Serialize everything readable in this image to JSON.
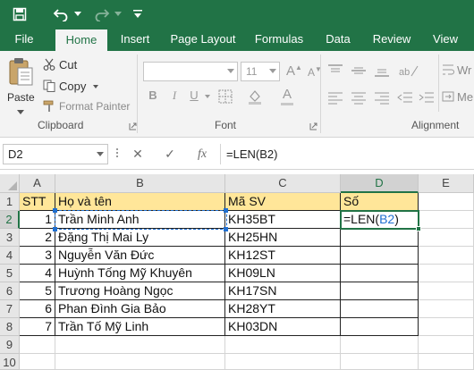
{
  "quick_access": {
    "save": "save-icon",
    "undo": "undo-icon",
    "redo": "redo-icon",
    "customize": "chevron-down-icon"
  },
  "tabs": [
    {
      "label": "File",
      "active": false
    },
    {
      "label": "Home",
      "active": true
    },
    {
      "label": "Insert",
      "active": false
    },
    {
      "label": "Page Layout",
      "active": false
    },
    {
      "label": "Formulas",
      "active": false
    },
    {
      "label": "Data",
      "active": false
    },
    {
      "label": "Review",
      "active": false
    },
    {
      "label": "View",
      "active": false
    }
  ],
  "ribbon": {
    "clipboard": {
      "paste": "Paste",
      "cut": "Cut",
      "copy": "Copy",
      "format_painter": "Format Painter",
      "group_label": "Clipboard"
    },
    "font": {
      "font_name": "",
      "font_size": "11",
      "bold": "B",
      "italic": "I",
      "underline": "U",
      "group_label": "Font"
    },
    "alignment": {
      "wrap": "Wr",
      "merge": "Me",
      "group_label": "Alignment"
    }
  },
  "formula_bar": {
    "name_box": "D2",
    "cancel": "✕",
    "enter": "✓",
    "fx": "fx",
    "formula_prefix": "=LEN(",
    "formula_ref": "B2",
    "formula_suffix": ")"
  },
  "columns": [
    "A",
    "B",
    "C",
    "D",
    "E"
  ],
  "rows": [
    "1",
    "2",
    "3",
    "4",
    "5",
    "6",
    "7",
    "8",
    "9",
    "10"
  ],
  "headers": {
    "stt": "STT",
    "name": "Họ và tên",
    "code": "Mã SV",
    "count": "Số"
  },
  "records": [
    {
      "stt": "1",
      "name": "Trần Minh Anh",
      "code": "KH35BT"
    },
    {
      "stt": "2",
      "name": "Đặng Thị Mai Ly",
      "code": "KH25HN"
    },
    {
      "stt": "3",
      "name": "Nguyễn Văn Đức",
      "code": "KH12ST"
    },
    {
      "stt": "4",
      "name": "Huỳnh Tống Mỹ Khuyên",
      "code": "KH09LN"
    },
    {
      "stt": "5",
      "name": "Trương Hoàng Ngọc",
      "code": "KH17SN"
    },
    {
      "stt": "6",
      "name": "Phan Đình Gia Bảo",
      "code": "KH28YT"
    },
    {
      "stt": "7",
      "name": "Trần Tố Mỹ Linh",
      "code": "KH03DN"
    }
  ],
  "active_cell": {
    "prefix": "=LEN(",
    "ref": "B2",
    "suffix": ")"
  },
  "colors": {
    "brand": "#217346",
    "header_fill": "#ffe699",
    "reference": "#1f6fd1"
  }
}
